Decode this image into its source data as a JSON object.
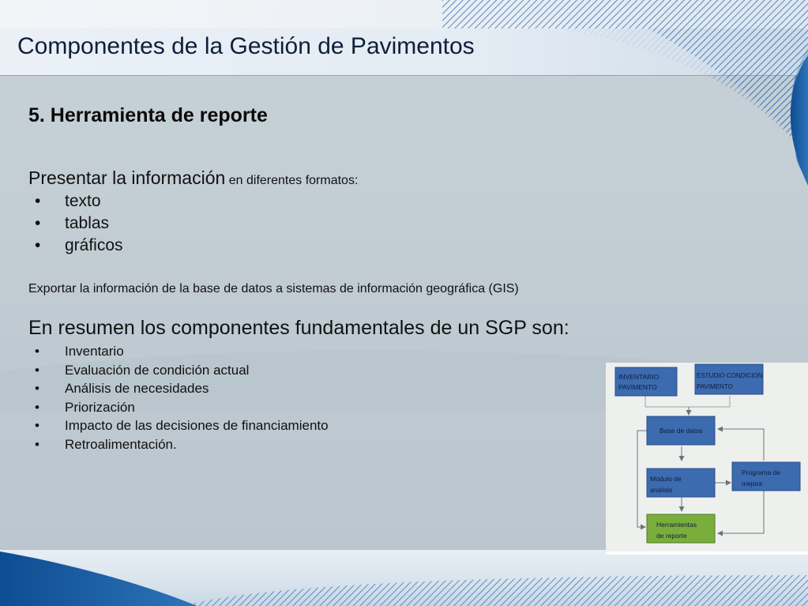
{
  "slide": {
    "title": "Componentes de la Gestión de Pavimentos",
    "section_heading": "5. Herramienta de reporte",
    "lead_main": "Presentar la información",
    "lead_small": " en diferentes formatos:",
    "formats": [
      "texto",
      "tablas",
      "gráficos"
    ],
    "export_text": "Exportar la información de la base de datos a sistemas de información geográfica (GIS)",
    "summary_heading": "En resumen los componentes fundamentales de un SGP son:",
    "components": [
      "Inventario",
      "Evaluación de condición actual",
      "Análisis de necesidades",
      "Priorización",
      "Impacto de las decisiones de financiamiento",
      "Retroalimentación."
    ]
  },
  "diagram": {
    "inventario_line1": "INVENTARIO",
    "inventario_line2": "PAVIMENTO",
    "estudio_line1": "ESTUDIO CONDICION",
    "estudio_line2": "PAVIMENTO",
    "base_datos": "Base de datos",
    "modulo_line1": "Módulo de",
    "modulo_line2": "análisis",
    "programa_line1": "Programa de",
    "programa_line2": "mejora",
    "herramientas_line1": "Herramientas",
    "herramientas_line2": "de reporte",
    "colors": {
      "blue_box": "#3c6bb0",
      "green_box": "#7aae3c",
      "box_border": "#2a4f88"
    }
  }
}
